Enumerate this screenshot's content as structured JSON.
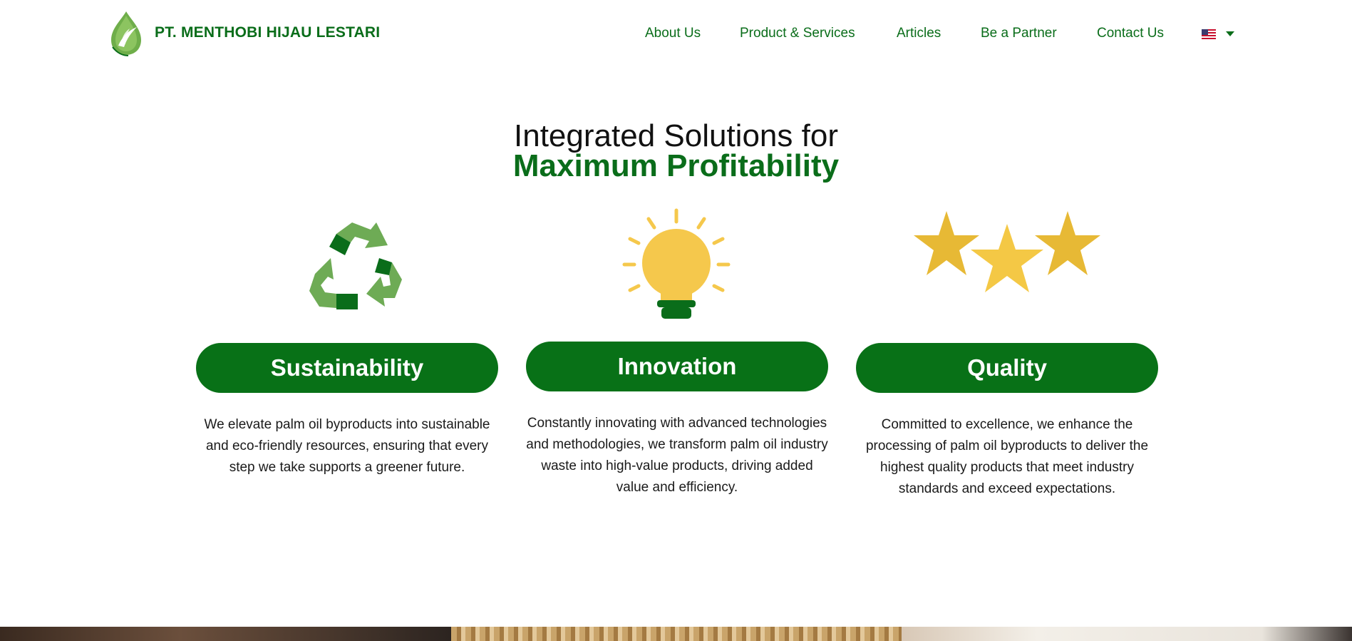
{
  "brand": {
    "name": "PT. MENTHOBI HIJAU LESTARI",
    "logo_icon": "palm-leaf-drop-logo"
  },
  "nav": {
    "items": [
      {
        "label": "About Us"
      },
      {
        "label": "Product & Services"
      },
      {
        "label": "Articles"
      },
      {
        "label": "Be a Partner"
      },
      {
        "label": "Contact Us"
      }
    ],
    "language": {
      "icon": "us-flag-icon",
      "dropdown_icon": "caret-down-icon"
    }
  },
  "hero": {
    "line1": "Integrated Solutions for",
    "line2": "Maximum Profitability"
  },
  "features": [
    {
      "icon": "recycle-icon",
      "title": "Sustainability",
      "description": "We elevate palm oil byproducts into sustainable and eco-friendly resources, ensuring that every step we take supports a greener future."
    },
    {
      "icon": "lightbulb-icon",
      "title": "Innovation",
      "description": "Constantly innovating with advanced technologies and methodologies, we transform palm oil industry waste into high-value products, driving added value and efficiency."
    },
    {
      "icon": "three-stars-icon",
      "title": "Quality",
      "description": "Committed to excellence, we enhance the processing of palm oil byproducts to deliver the highest quality products that meet industry standards and exceed expectations."
    }
  ],
  "colors": {
    "brand_green": "#0a6d1a",
    "pill_green": "#087117",
    "recycle_light": "#6eab55",
    "recycle_dark": "#0a6d1a",
    "bulb_yellow": "#f5c84c",
    "star_gold": "#e7b935"
  }
}
